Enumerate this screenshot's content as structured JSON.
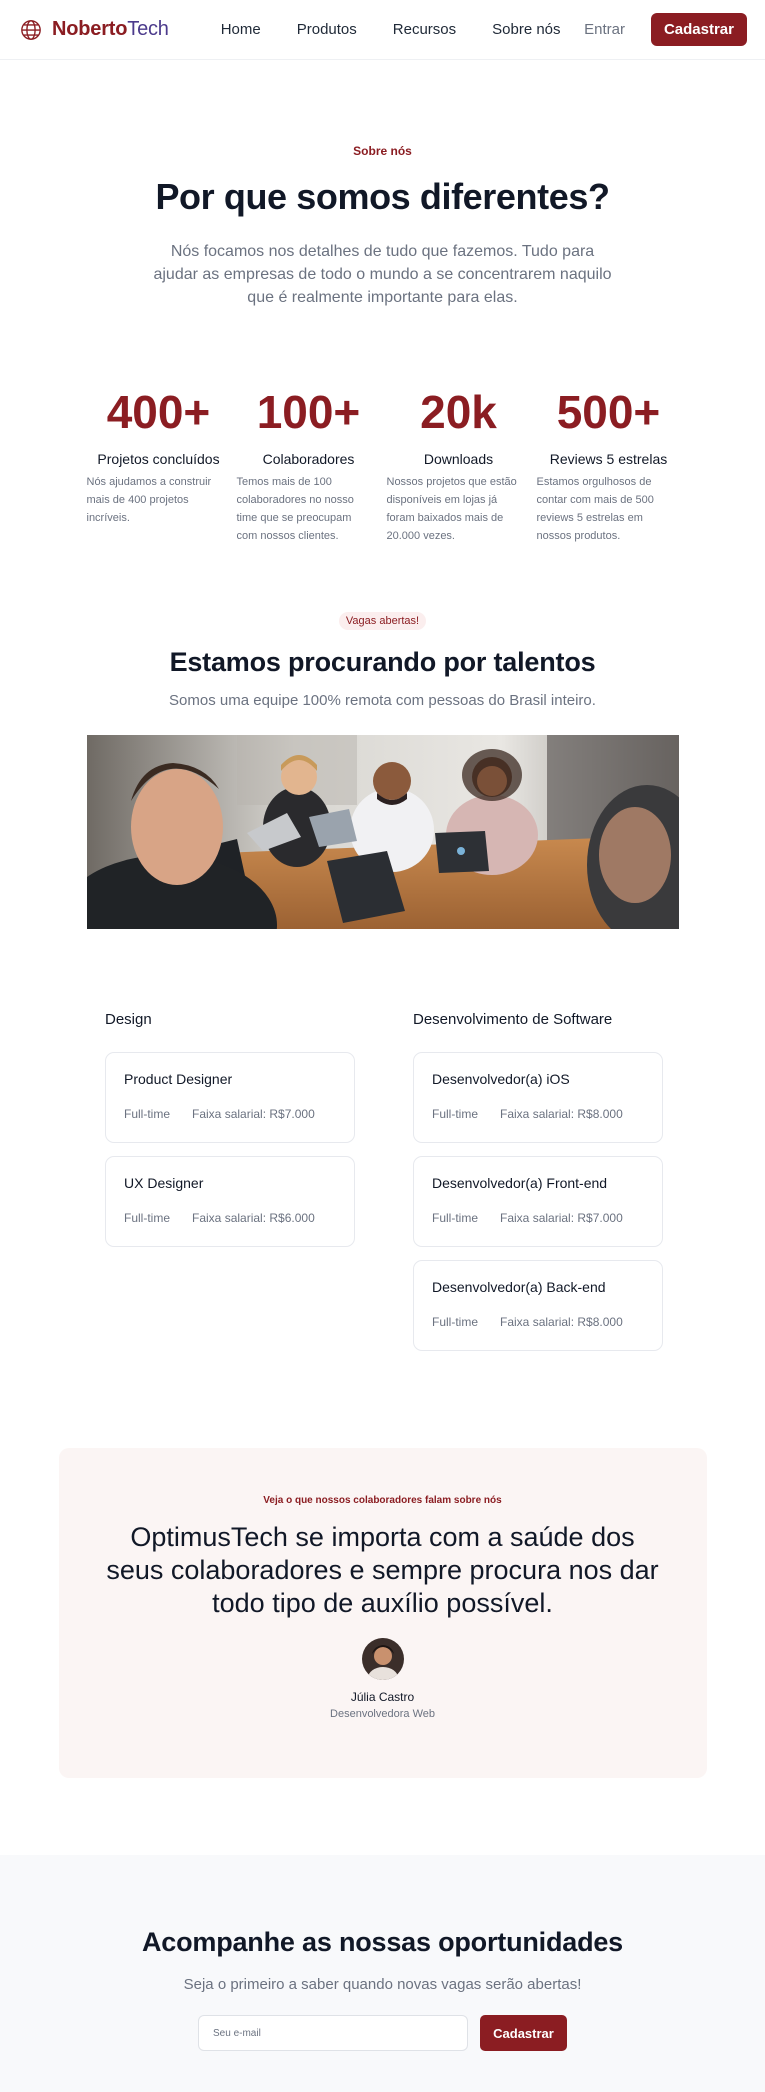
{
  "header": {
    "brand_bold": "Noberto",
    "brand_light": "Tech",
    "nav": [
      "Home",
      "Produtos",
      "Recursos",
      "Sobre nós"
    ],
    "login_label": "Entrar",
    "signup_label": "Cadastrar"
  },
  "about": {
    "eyebrow": "Sobre nós",
    "title": "Por que somos diferentes?",
    "text": "Nós focamos nos detalhes de tudo que fazemos. Tudo para ajudar as empresas de todo o mundo a se concentrarem naquilo que é realmente importante para elas."
  },
  "stats": [
    {
      "value": "400+",
      "label": "Projetos concluídos",
      "desc": "Nós ajudamos a construir mais de 400 projetos incríveis."
    },
    {
      "value": "100+",
      "label": "Colaboradores",
      "desc": "Temos mais de 100 colaboradores no nosso time que se preocupam com nossos clientes."
    },
    {
      "value": "20k",
      "label": "Downloads",
      "desc": "Nossos projetos que estão disponíveis em lojas já foram baixados mais de 20.000 vezes."
    },
    {
      "value": "500+",
      "label": "Reviews 5 estrelas",
      "desc": "Estamos orgulhosos de contar com mais de 500 reviews 5 estrelas em nossos produtos."
    }
  ],
  "talent": {
    "pill": "Vagas abertas!",
    "title": "Estamos procurando por talentos",
    "subtitle": "Somos uma equipe 100% remota com pessoas do Brasil inteiro."
  },
  "jobs": {
    "design": {
      "title": "Design",
      "items": [
        {
          "title": "Product Designer",
          "type": "Full-time",
          "salary": "Faixa salarial: R$7.000"
        },
        {
          "title": "UX Designer",
          "type": "Full-time",
          "salary": "Faixa salarial: R$6.000"
        }
      ]
    },
    "dev": {
      "title": "Desenvolvimento de Software",
      "items": [
        {
          "title": "Desenvolvedor(a) iOS",
          "type": "Full-time",
          "salary": "Faixa salarial: R$8.000"
        },
        {
          "title": "Desenvolvedor(a) Front-end",
          "type": "Full-time",
          "salary": "Faixa salarial: R$7.000"
        },
        {
          "title": "Desenvolvedor(a) Back-end",
          "type": "Full-time",
          "salary": "Faixa salarial: R$8.000"
        }
      ]
    }
  },
  "testimonial": {
    "eyebrow": "Veja o que nossos colaboradores falam sobre nós",
    "quote": "OptimusTech se importa com a saúde dos seus colaboradores e sempre procura nos dar todo tipo de auxílio possível.",
    "name": "Júlia Castro",
    "role": "Desenvolvedora Web"
  },
  "newsletter": {
    "title": "Acompanhe as nossas oportunidades",
    "subtitle": "Seja o primeiro a saber quando novas vagas serão abertas!",
    "placeholder": "Seu e-mail",
    "button": "Cadastrar"
  },
  "colors": {
    "accent": "#8b1d22",
    "brand_secondary": "#4c3b8c",
    "muted": "#6b7280"
  }
}
